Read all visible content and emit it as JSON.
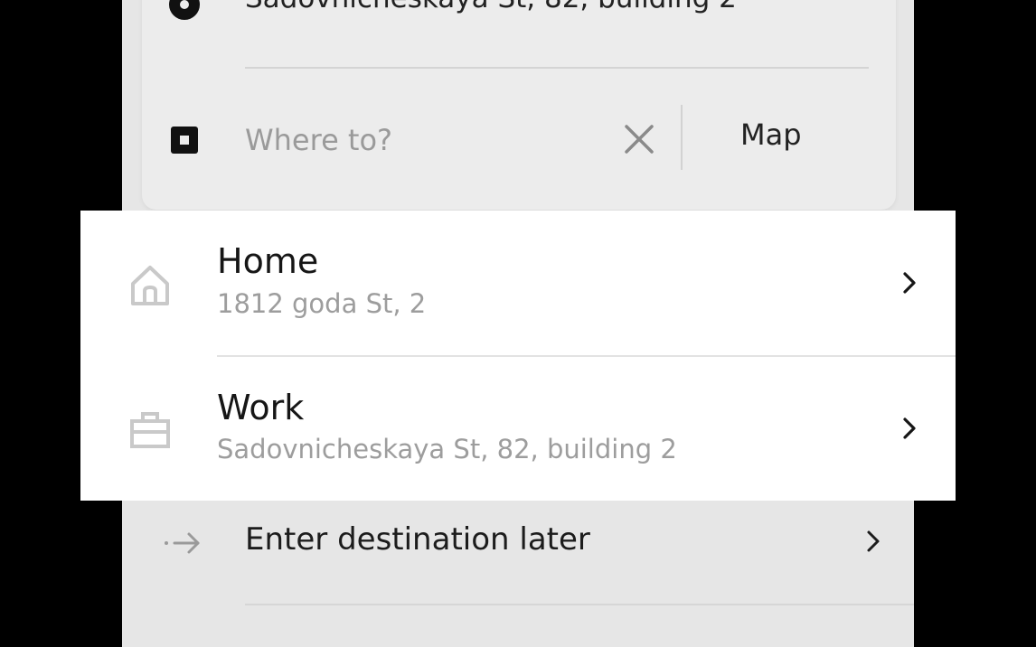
{
  "search": {
    "pickup_address": "Sadovnicheskaya St, 82, building 2",
    "destination_placeholder": "Where to?",
    "map_label": "Map"
  },
  "saved_places": [
    {
      "title": "Home",
      "address": "1812 goda St, 2",
      "icon": "home-icon"
    },
    {
      "title": "Work",
      "address": "Sadovnicheskaya St, 82, building 2",
      "icon": "briefcase-icon"
    }
  ],
  "enter_later": {
    "label": "Enter destination later",
    "icon": "arrow-right-icon"
  },
  "colors": {
    "background": "#e6e6e6",
    "card": "#ececec",
    "popup": "#ffffff",
    "primary_text": "#161616",
    "secondary_text": "#9d9d9d"
  }
}
